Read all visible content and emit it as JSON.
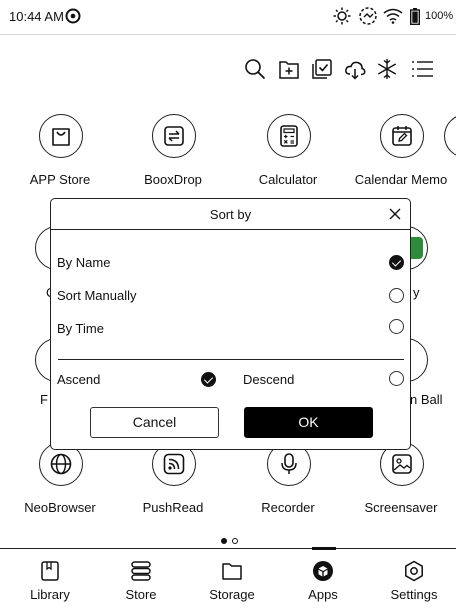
{
  "status_bar": {
    "time": "10:44 AM",
    "battery": "100%"
  },
  "toolbar": {
    "icons": [
      "search-icon",
      "add-folder-icon",
      "multi-select-icon",
      "cloud-icon",
      "freeze-icon",
      "menu-icon"
    ]
  },
  "apps": [
    {
      "label": "APP Store"
    },
    {
      "label": "BooxDrop"
    },
    {
      "label": "Calculator"
    },
    {
      "label": "Calendar Memo"
    },
    {
      "label": "NeoBrowser"
    },
    {
      "label": "PushRead"
    },
    {
      "label": "Recorder"
    },
    {
      "label": "Screensaver"
    }
  ],
  "partial_labels": {
    "left_row2": "C",
    "right_row2": "y",
    "left_row3": "F",
    "right_row3": "n Ball"
  },
  "dialog": {
    "title": "Sort by",
    "options": [
      {
        "label": "By Name",
        "selected": true
      },
      {
        "label": "Sort Manually",
        "selected": false
      },
      {
        "label": "By Time",
        "selected": false
      }
    ],
    "order": [
      {
        "label": "Ascend",
        "selected": true
      },
      {
        "label": "Descend",
        "selected": false
      }
    ],
    "cancel": "Cancel",
    "ok": "OK"
  },
  "pager": {
    "current": 1,
    "total": 2
  },
  "nav": [
    {
      "label": "Library",
      "active": false
    },
    {
      "label": "Store",
      "active": false
    },
    {
      "label": "Storage",
      "active": false
    },
    {
      "label": "Apps",
      "active": true
    },
    {
      "label": "Settings",
      "active": false
    }
  ]
}
